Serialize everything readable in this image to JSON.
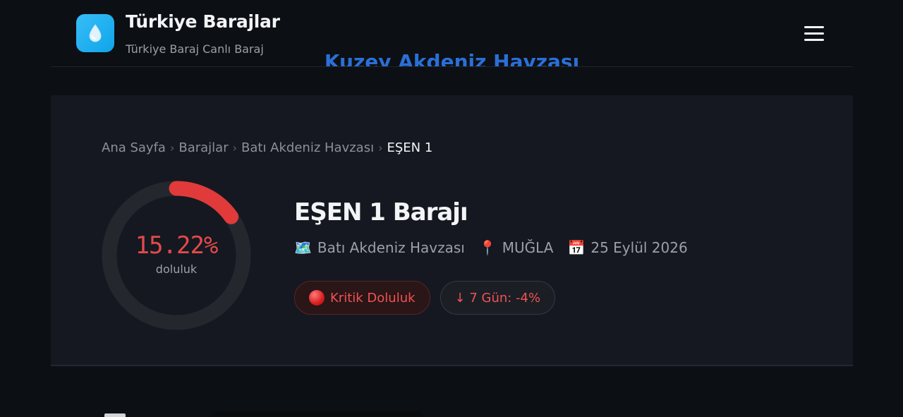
{
  "header": {
    "title": "Türkiye Barajlar",
    "subtitle": "Türkiye Baraj Canlı Baraj",
    "logo_icon": "water-drop-icon",
    "menu_icon": "hamburger-menu-icon",
    "behind_text": "Kuzey Akdeniz Havzası"
  },
  "breadcrumb": {
    "items": [
      "Ana Sayfa",
      "Barajlar",
      "Batı Akdeniz Havzası"
    ],
    "separator": "›",
    "current": "EŞEN 1"
  },
  "gauge": {
    "value_text": "15.22%",
    "fill_fraction": 0.1522,
    "label": "doluluk",
    "color": "#e03a3a",
    "track_color": "#24272e"
  },
  "dam": {
    "title": "EŞEN 1 Barajı",
    "meta": [
      {
        "icon": "map-icon",
        "glyph": "🗺️",
        "text": "Batı Akdeniz Havzası"
      },
      {
        "icon": "pin-icon",
        "glyph": "📍",
        "text": "MUĞLA"
      },
      {
        "icon": "calendar-icon",
        "glyph": "📅",
        "text": "25 Eylül 2026"
      }
    ]
  },
  "badges": {
    "critical": "Kritik Doluluk",
    "trend": "↓ 7 Gün: -4%"
  },
  "colors": {
    "background": "#0c0f14",
    "card": "#151820",
    "accent_red": "#f05252"
  }
}
